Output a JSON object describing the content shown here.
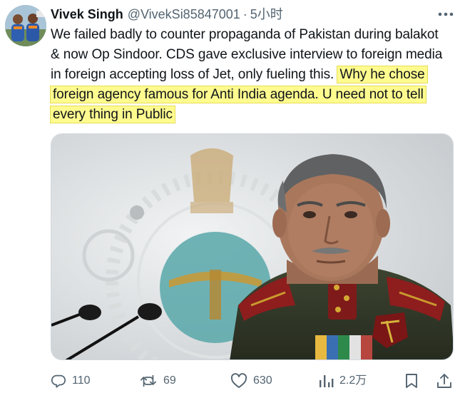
{
  "author": {
    "display_name": "Vivek Singh",
    "handle": "@VivekSi85847001",
    "separator": "·",
    "time": "5小时"
  },
  "tweet": {
    "text_plain": "We failed badly to counter propaganda of Pakistan during balakot & now Op Sindoor. CDS gave exclusive interview to foreign media in foreign accepting loss of Jet, only fueling this.",
    "text_highlighted": "Why he chose foreign agency famous for Anti India agenda. U need not to tell every thing in Public",
    "highlight_color": "#fffb8f"
  },
  "actions": {
    "replies": "110",
    "retweets": "69",
    "likes": "630",
    "views": "2.2万"
  },
  "icons": {
    "more": "more-dots-icon",
    "reply": "reply-icon",
    "retweet": "retweet-icon",
    "like": "heart-icon",
    "views": "views-bar-chart-icon",
    "bookmark": "bookmark-icon",
    "share": "share-icon"
  },
  "colors": {
    "text": "#0f1419",
    "secondary": "#536471"
  }
}
